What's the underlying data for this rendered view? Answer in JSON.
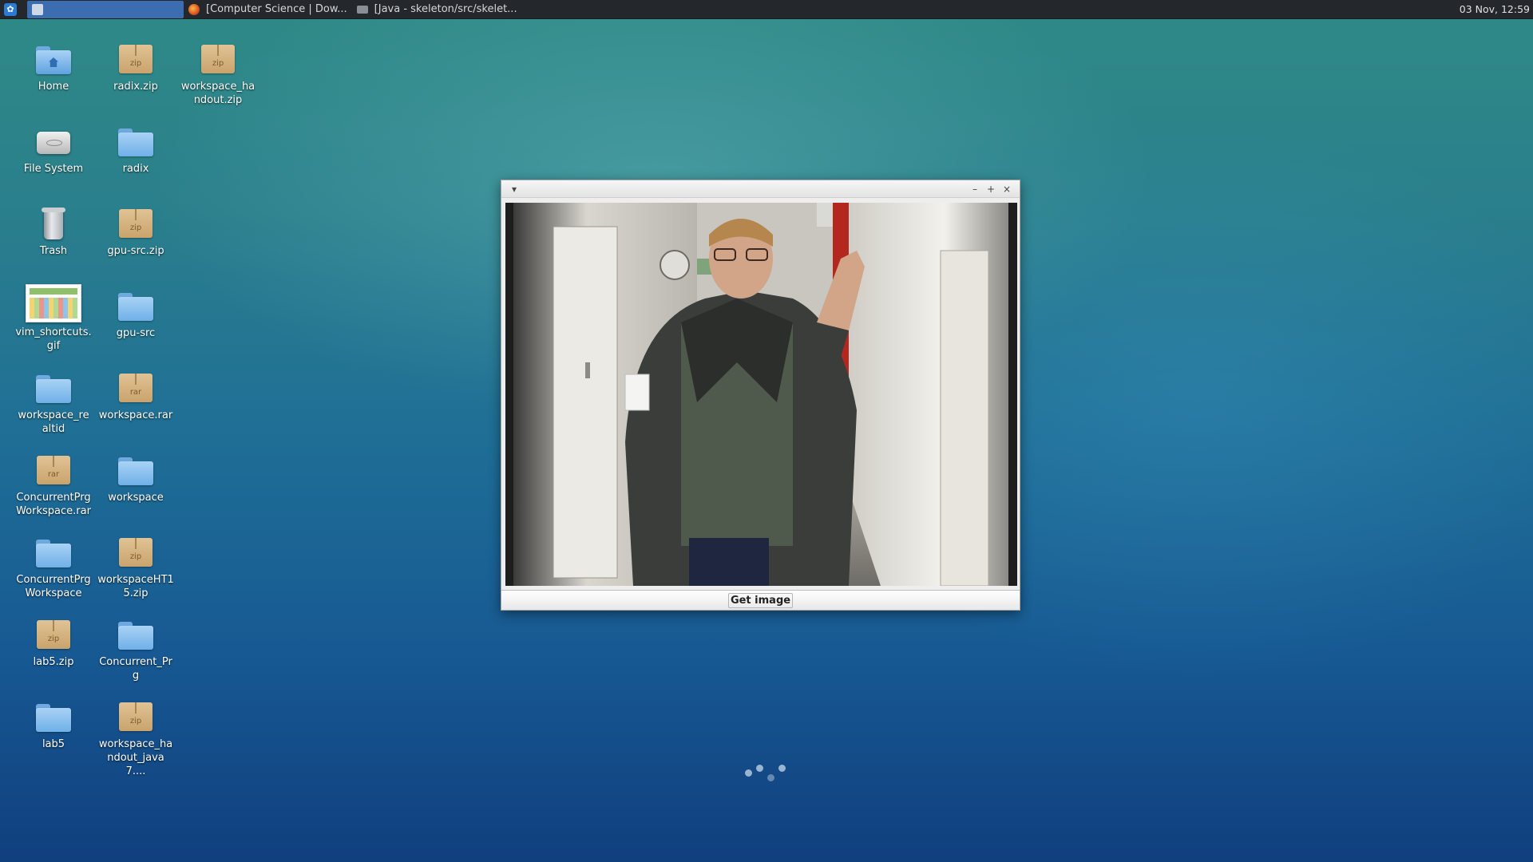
{
  "panel": {
    "tasks": [
      {
        "label": ""
      },
      {
        "label": "[Computer Science | Dow..."
      },
      {
        "label": "[Java - skeleton/src/skelet..."
      }
    ],
    "clock": "03 Nov, 12:59"
  },
  "desktop": {
    "icons": [
      {
        "label": "Home",
        "icon": "home-folder-icon"
      },
      {
        "label": "radix.zip",
        "icon": "zip-archive-icon",
        "ext": "zip"
      },
      {
        "label": "workspace_handout.zip",
        "icon": "zip-archive-icon",
        "ext": "zip"
      },
      {
        "label": "File System",
        "icon": "drive-icon"
      },
      {
        "label": "radix",
        "icon": "folder-icon"
      },
      {
        "label": "Trash",
        "icon": "trash-icon"
      },
      {
        "label": "gpu-src.zip",
        "icon": "zip-archive-icon",
        "ext": "zip"
      },
      {
        "label": "vim_shortcuts.gif",
        "icon": "image-file-icon"
      },
      {
        "label": "gpu-src",
        "icon": "folder-icon"
      },
      {
        "label": "workspace_realtid",
        "icon": "folder-icon"
      },
      {
        "label": "workspace.rar",
        "icon": "rar-archive-icon",
        "ext": "rar"
      },
      {
        "label": "ConcurrentPrgWorkspace.rar",
        "icon": "rar-archive-icon",
        "ext": "rar"
      },
      {
        "label": "workspace",
        "icon": "folder-icon"
      },
      {
        "label": "ConcurrentPrgWorkspace",
        "icon": "folder-icon"
      },
      {
        "label": "workspaceHT15.zip",
        "icon": "zip-archive-icon",
        "ext": "zip"
      },
      {
        "label": "lab5.zip",
        "icon": "zip-archive-icon",
        "ext": "zip"
      },
      {
        "label": "Concurrent_Prg",
        "icon": "folder-icon"
      },
      {
        "label": "lab5",
        "icon": "folder-icon"
      },
      {
        "label": "workspace_handout_java7....",
        "icon": "zip-archive-icon",
        "ext": "zip"
      }
    ]
  },
  "window": {
    "menu_glyph": "▾",
    "minimize": "–",
    "maximize": "+",
    "close": "×",
    "button_label": "Get image"
  },
  "colors": {
    "panel_bg": "#24282c",
    "active_task": "#3c6db0",
    "folder": "#6fb0e8",
    "archive": "#c9a36c"
  }
}
